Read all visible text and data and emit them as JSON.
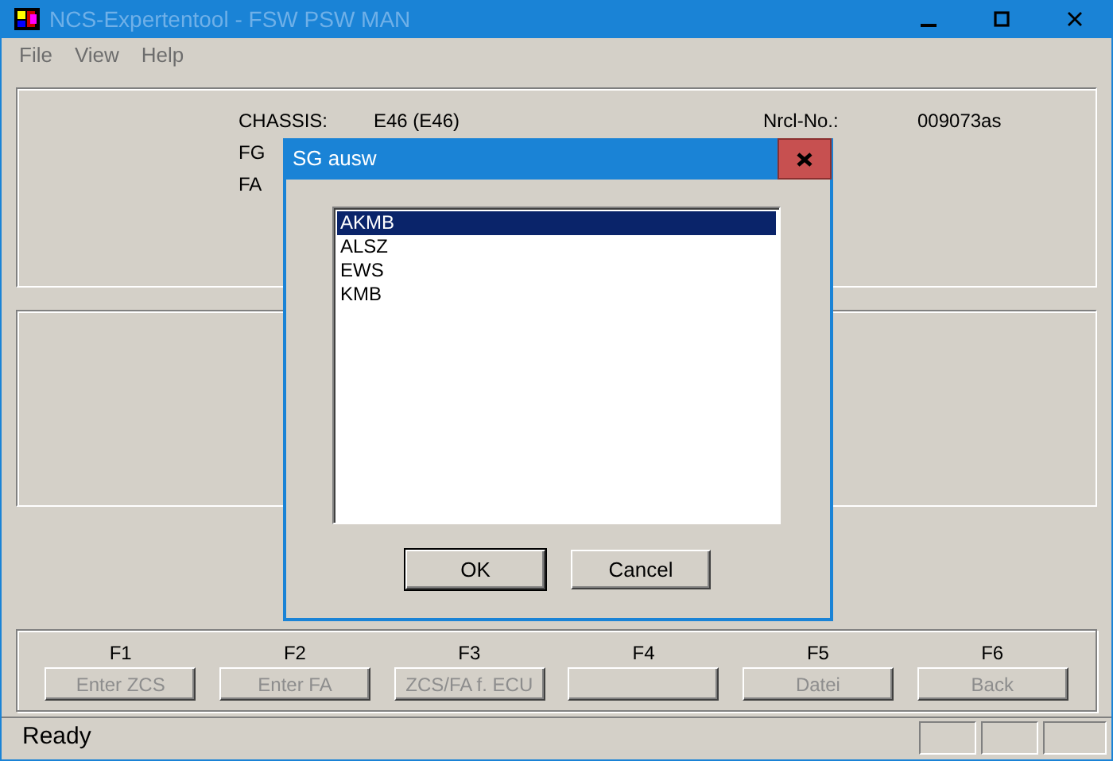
{
  "window": {
    "title": "NCS-Expertentool - FSW PSW MAN",
    "active": false
  },
  "menu": [
    "File",
    "View",
    "Help"
  ],
  "info": [
    {
      "label": "CHASSIS:",
      "value": "E46 (E46)"
    },
    {
      "label": "FG"
    },
    {
      "label": "FA"
    }
  ],
  "nrcl": {
    "label": "Nrcl-No.:",
    "value": "009073as"
  },
  "dialog": {
    "title": "SG ausw",
    "items": [
      {
        "text": "AKMB",
        "selected": true
      },
      {
        "text": "ALSZ",
        "selected": false
      },
      {
        "text": "EWS",
        "selected": false
      },
      {
        "text": "KMB",
        "selected": false
      }
    ],
    "buttons": [
      {
        "label": "OK",
        "default": true
      },
      {
        "label": "Cancel",
        "default": false
      }
    ]
  },
  "function_keys": [
    {
      "key": "F1",
      "label": "Enter ZCS",
      "disabled": true
    },
    {
      "key": "F2",
      "label": "Enter FA",
      "disabled": true
    },
    {
      "key": "F3",
      "label": "ZCS/FA f. ECU",
      "disabled": true
    },
    {
      "key": "F4"
    },
    {
      "key": "F5",
      "label": "Datei",
      "disabled": true
    },
    {
      "key": "F6",
      "label": "Back",
      "disabled": true
    }
  ],
  "status_bar": {
    "text": "Ready"
  }
}
